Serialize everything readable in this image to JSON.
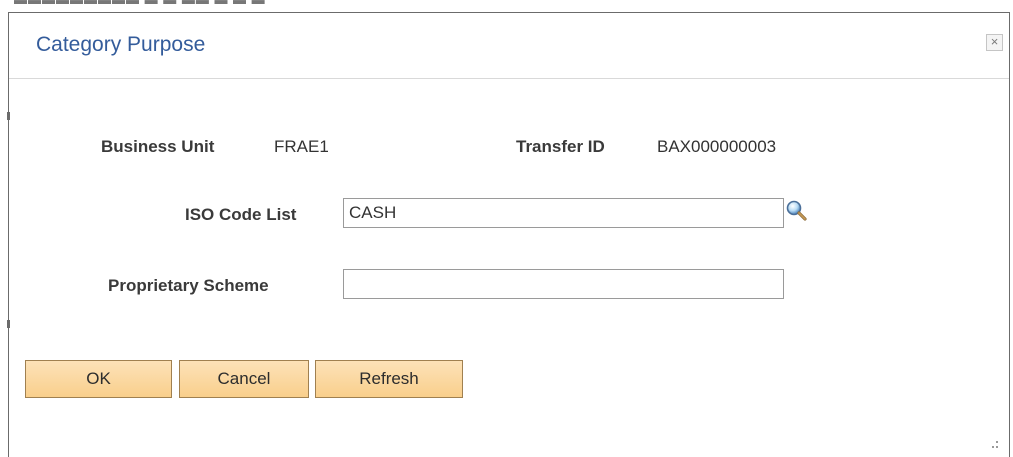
{
  "dialog": {
    "title": "Category Purpose",
    "close_label": "×"
  },
  "header": {
    "business_unit_label": "Business Unit",
    "business_unit_value": "FRAE1",
    "transfer_id_label": "Transfer ID",
    "transfer_id_value": "BAX000000003"
  },
  "form": {
    "iso_code_label": "ISO Code List",
    "iso_code_value": "CASH",
    "proprietary_label": "Proprietary Scheme",
    "proprietary_value": ""
  },
  "buttons": {
    "ok": "OK",
    "cancel": "Cancel",
    "refresh": "Refresh"
  },
  "icons": {
    "lookup": "magnifier-icon",
    "close": "close-icon",
    "resize": "resize-grip-icon"
  },
  "colors": {
    "title": "#345c9b",
    "button_fill": "#f9cf8c",
    "button_border": "#a08050"
  }
}
